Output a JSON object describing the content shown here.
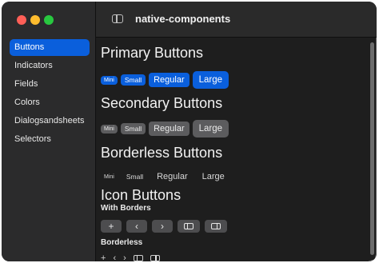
{
  "window": {
    "title": "native-components"
  },
  "sidebar": {
    "items": [
      {
        "label": "Buttons",
        "active": true
      },
      {
        "label": "Indicators",
        "active": false
      },
      {
        "label": "Fields",
        "active": false
      },
      {
        "label": "Colors",
        "active": false
      },
      {
        "label": "Dialogsandsheets",
        "active": false
      },
      {
        "label": "Selectors",
        "active": false
      }
    ]
  },
  "sections": {
    "primary": {
      "heading": "Primary Buttons",
      "buttons": [
        "Mini",
        "Small",
        "Regular",
        "Large"
      ]
    },
    "secondary": {
      "heading": "Secondary Buttons",
      "buttons": [
        "Mini",
        "Small",
        "Regular",
        "Large"
      ]
    },
    "borderless": {
      "heading": "Borderless Buttons",
      "buttons": [
        "Mini",
        "Small",
        "Regular",
        "Large"
      ]
    },
    "icon": {
      "heading": "Icon Buttons",
      "with_borders_label": "With Borders",
      "borderless_label": "Borderless",
      "icons": [
        "plus-icon",
        "chevron-left-icon",
        "chevron-right-icon",
        "sidebar-left-icon",
        "sidebar-right-icon"
      ]
    }
  },
  "colors": {
    "accent": "#0a5fdc",
    "secondary_button": "#5c5c5e",
    "window_bg": "#1e1e1e",
    "sidebar_bg": "#2b2b2c"
  }
}
